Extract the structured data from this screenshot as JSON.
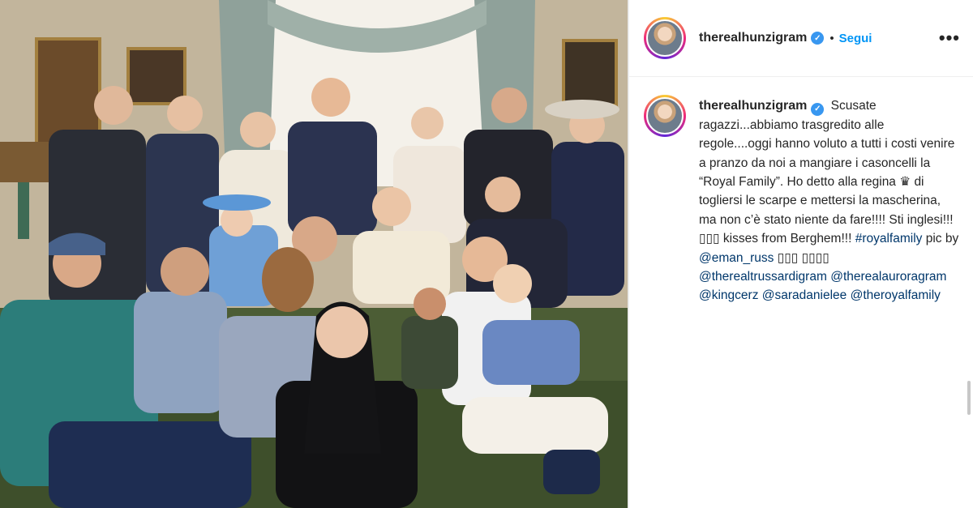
{
  "post": {
    "photo_alt": "Family group portrait",
    "header": {
      "username": "therealhunzigram",
      "verified_symbol": "✓",
      "separator": "•",
      "follow_label": "Segui",
      "more_icon": "•••"
    },
    "caption": {
      "username": "therealhunzigram",
      "text_1": "Scusate ragazzi...abbiamo trasgredito alle regole....oggi hanno voluto a tutti i costi venire a pranzo da noi a mangiare i casoncelli la “Royal Family”. Ho detto alla regina ♛ di togliersi le scarpe e mettersi la mascherina, ma non c’è stato niente da fare!!!! Sti inglesi!!! ▯▯▯ kisses from Berghem!!!",
      "hashtag": "#royalfamily",
      "text_2": "pic by",
      "mention_1": "@eman_russ",
      "text_3": "▯▯▯ ▯▯▯▯",
      "mention_2": "@therealtrussardigram",
      "mention_3": "@therealauroragram",
      "mention_4": "@kingcerz",
      "mention_5": "@saradanielee",
      "mention_6": "@theroyalfamily"
    }
  },
  "colors": {
    "link_blue": "#0095f6",
    "mention_blue": "#00376b",
    "verified_blue": "#3897f0"
  }
}
